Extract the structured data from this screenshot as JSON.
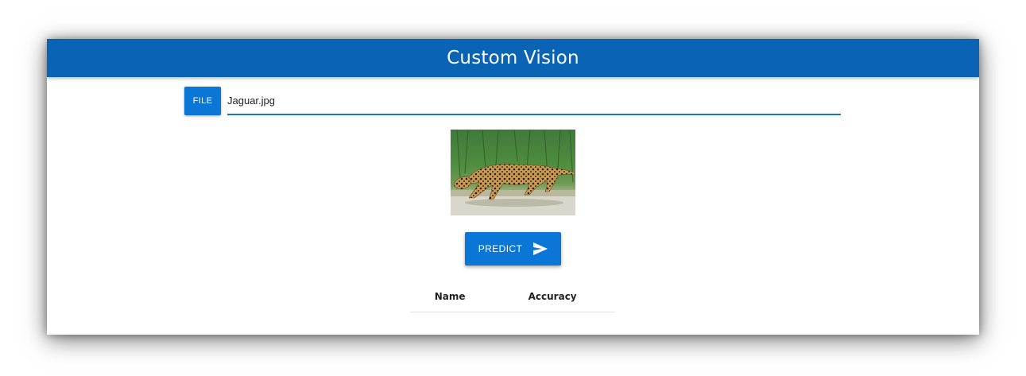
{
  "app": {
    "title": "Custom Vision"
  },
  "file_picker": {
    "button_label": "FILE",
    "selected_file": "Jaguar.jpg"
  },
  "preview": {
    "description_icon": "jaguar-photo"
  },
  "actions": {
    "predict_label": "PREDICT",
    "predict_icon": "send-icon"
  },
  "results": {
    "columns": [
      "Name",
      "Accuracy"
    ],
    "rows": []
  },
  "colors": {
    "app_bar": "#0a63b4",
    "button": "#0a76d6",
    "underline": "#1c74c8"
  }
}
